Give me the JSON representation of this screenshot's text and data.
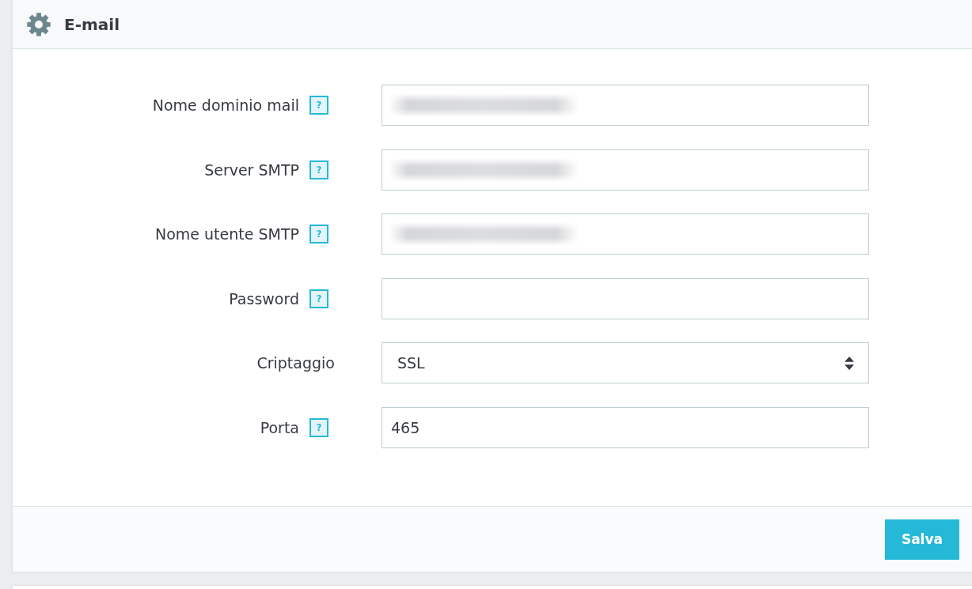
{
  "panel": {
    "title": "E-mail",
    "fields": [
      {
        "label": "Nome dominio mail",
        "help": "?",
        "kind": "input",
        "blurred": true
      },
      {
        "label": "Server SMTP",
        "help": "?",
        "kind": "input",
        "blurred": true
      },
      {
        "label": "Nome utente SMTP",
        "help": "?",
        "kind": "input",
        "blurred": true
      },
      {
        "label": "Password",
        "help": "?",
        "kind": "input",
        "blurred": false
      },
      {
        "label": "Criptaggio",
        "kind": "select",
        "value": "SSL",
        "blurred": false
      },
      {
        "label": "Porta",
        "help": "?",
        "kind": "input",
        "value": "465",
        "blurred": false
      }
    ],
    "buttons": [
      "Salva"
    ]
  }
}
